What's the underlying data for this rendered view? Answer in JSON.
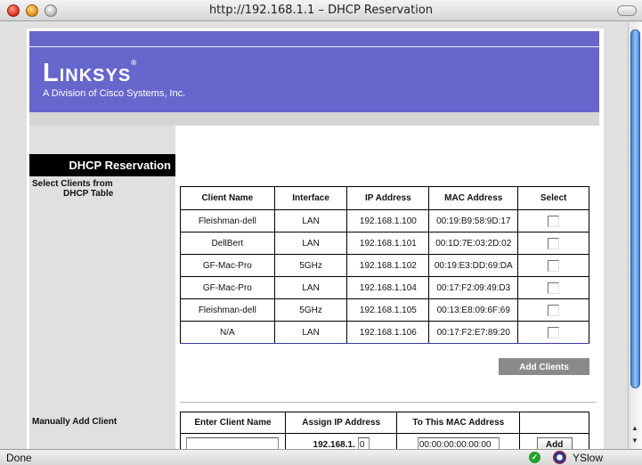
{
  "window": {
    "title": "http://192.168.1.1 – DHCP Reservation"
  },
  "header": {
    "logo": "Linksys",
    "logo_mark": "®",
    "subtitle": "A Division of Cisco Systems, Inc."
  },
  "sidebar": {
    "section_title": "DHCP Reservation",
    "select_label_line1": "Select Clients from",
    "select_label_line2": "DHCP Table",
    "manual_label": "Manually Add Client"
  },
  "clients_table": {
    "headers": [
      "Client Name",
      "Interface",
      "IP Address",
      "MAC Address",
      "Select"
    ],
    "rows": [
      {
        "name": "Fleishman-dell",
        "interface": "LAN",
        "ip": "192.168.1.100",
        "mac": "00:19:B9:58:9D:17",
        "selected": false
      },
      {
        "name": "DellBert",
        "interface": "LAN",
        "ip": "192.168.1.101",
        "mac": "00:1D:7E:03:2D:02",
        "selected": false
      },
      {
        "name": "GF-Mac-Pro",
        "interface": "5GHz",
        "ip": "192.168.1.102",
        "mac": "00:19:E3:DD:69:DA",
        "selected": false
      },
      {
        "name": "GF-Mac-Pro",
        "interface": "LAN",
        "ip": "192.168.1.104",
        "mac": "00:17:F2:09:49:D3",
        "selected": false
      },
      {
        "name": "Fleishman-dell",
        "interface": "5GHz",
        "ip": "192.168.1.105",
        "mac": "00:13:E8:09:6F:69",
        "selected": false
      },
      {
        "name": "N/A",
        "interface": "LAN",
        "ip": "192.168.1.106",
        "mac": "00:17:F2:E7:89:20",
        "selected": false
      }
    ],
    "add_clients_label": "Add Clients"
  },
  "manual_add": {
    "headers": [
      "Enter Client Name",
      "Assign IP Address",
      "To This MAC Address"
    ],
    "client_name_value": "",
    "ip_prefix": "192.168.1.",
    "ip_last_octet": "0",
    "mac_value": "00:00:00:00:00:00",
    "add_label": "Add"
  },
  "statusbar": {
    "status": "Done",
    "yslow": "YSlow"
  },
  "colors": {
    "header": "#6666cc",
    "section_title_bg": "#000000",
    "left_column": "#e0e0e0",
    "button_gray": "#8a8a8a"
  }
}
